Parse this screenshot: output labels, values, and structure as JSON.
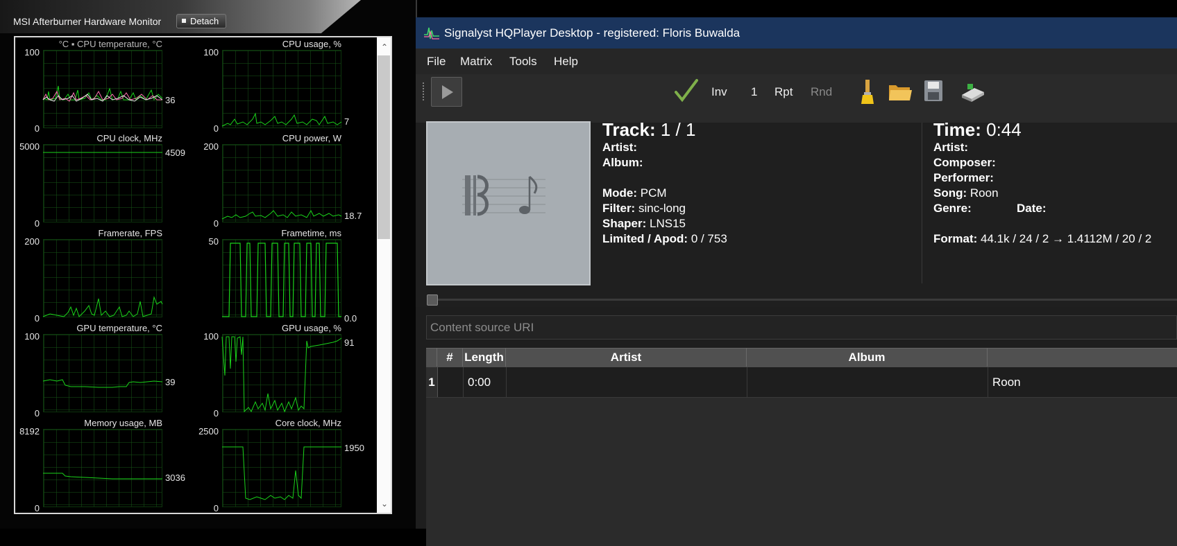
{
  "afterburner": {
    "title": "MSI Afterburner Hardware Monitor",
    "detach_label": "Detach",
    "graphs": [
      {
        "title": "°C ▪ CPU temperature, °C",
        "max": "100",
        "min": "0",
        "current": "36"
      },
      {
        "title": "CPU usage, %",
        "max": "100",
        "min": "0",
        "current": "7"
      },
      {
        "title": "CPU clock, MHz",
        "max": "5000",
        "min": "0",
        "current": "4509"
      },
      {
        "title": "CPU power, W",
        "max": "200",
        "min": "0",
        "current": "18.7"
      },
      {
        "title": "Framerate, FPS",
        "max": "200",
        "min": "0",
        "current": ""
      },
      {
        "title": "Frametime, ms",
        "max": "50",
        "min": "",
        "current": "0.0"
      },
      {
        "title": "GPU temperature, °C",
        "max": "100",
        "min": "0",
        "current": "39"
      },
      {
        "title": "GPU usage, %",
        "max": "100",
        "min": "0",
        "current": "91"
      },
      {
        "title": "Memory usage, MB",
        "max": "8192",
        "min": "0",
        "current": "3036"
      },
      {
        "title": "Core clock, MHz",
        "max": "2500",
        "min": "0",
        "current": "1950"
      }
    ]
  },
  "hqplayer": {
    "title": "Signalyst HQPlayer Desktop - registered: Floris Buwalda",
    "menu": {
      "file": "File",
      "matrix": "Matrix",
      "tools": "Tools",
      "help": "Help"
    },
    "toolbar": {
      "inv": "Inv",
      "count": "1",
      "rpt": "Rpt",
      "rnd": "Rnd"
    },
    "track": {
      "title_label": "Track:",
      "title_value": "1 / 1",
      "artist_label": "Artist:",
      "album_label": "Album:",
      "mode_label": "Mode:",
      "mode_value": "PCM",
      "filter_label": "Filter:",
      "filter_value": "sinc-long",
      "shaper_label": "Shaper:",
      "shaper_value": "LNS15",
      "limited_label": "Limited / Apod:",
      "limited_value": "0 / 753"
    },
    "time": {
      "title_label": "Time:",
      "title_value": "0:44",
      "artist_label": "Artist:",
      "composer_label": "Composer:",
      "performer_label": "Performer:",
      "song_label": "Song:",
      "song_value": "Roon",
      "genre_label": "Genre:",
      "date_label": "Date:",
      "format_label": "Format:",
      "format_value": "44.1k / 24 / 2 → 1.4112M / 20 / 2"
    },
    "uri_placeholder": "Content source URI",
    "playlist": {
      "headers": [
        "#",
        "Length",
        "Artist",
        "Album"
      ],
      "rows": [
        {
          "num": "1",
          "length": "0:00",
          "artist": "",
          "album": "",
          "title": "Roon"
        }
      ]
    }
  }
}
